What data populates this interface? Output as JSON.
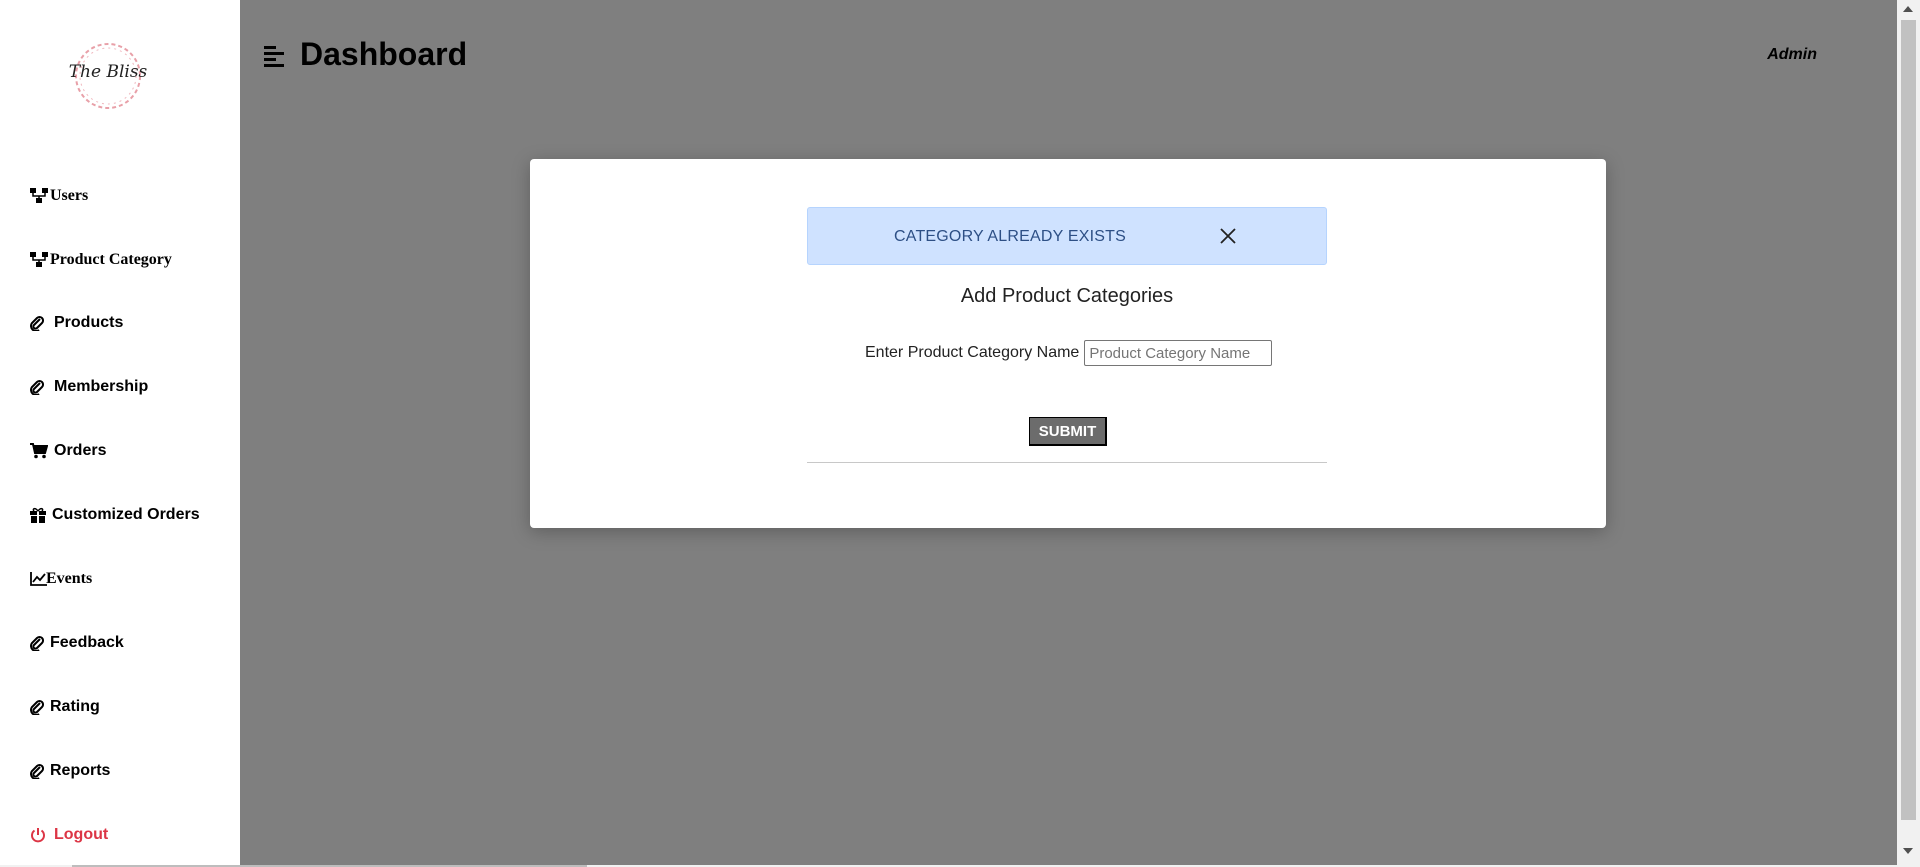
{
  "sidebar": {
    "logo_text": "The Bliss",
    "items": [
      {
        "label": "Users",
        "icon": "sitemap-icon"
      },
      {
        "label": "Product Category",
        "icon": "sitemap-icon"
      },
      {
        "label": "Products",
        "icon": "paperclip-icon"
      },
      {
        "label": "Membership",
        "icon": "paperclip-icon"
      },
      {
        "label": "Orders",
        "icon": "cart-icon"
      },
      {
        "label": "Customized Orders",
        "icon": "gift-icon"
      },
      {
        "label": "Events",
        "icon": "chart-line-icon"
      },
      {
        "label": "Feedback",
        "icon": "paperclip-icon"
      },
      {
        "label": "Rating",
        "icon": "paperclip-icon"
      },
      {
        "label": "Reports",
        "icon": "paperclip-icon"
      },
      {
        "label": "Logout",
        "icon": "power-icon"
      }
    ]
  },
  "header": {
    "title": "Dashboard",
    "user": "Admin"
  },
  "modal": {
    "alert_text": "CATEGORY ALREADY EXISTS",
    "title": "Add Product Categories",
    "field_label": "Enter Product Category Name",
    "field_value": "",
    "field_placeholder": "Product Category Name",
    "submit_label": "SUBMIT"
  },
  "colors": {
    "overlay": "#808080",
    "alert_bg": "#cfe2ff",
    "alert_text": "#2d4f85",
    "logout": "#dc3545",
    "submit_bg": "#6c6c6c"
  }
}
